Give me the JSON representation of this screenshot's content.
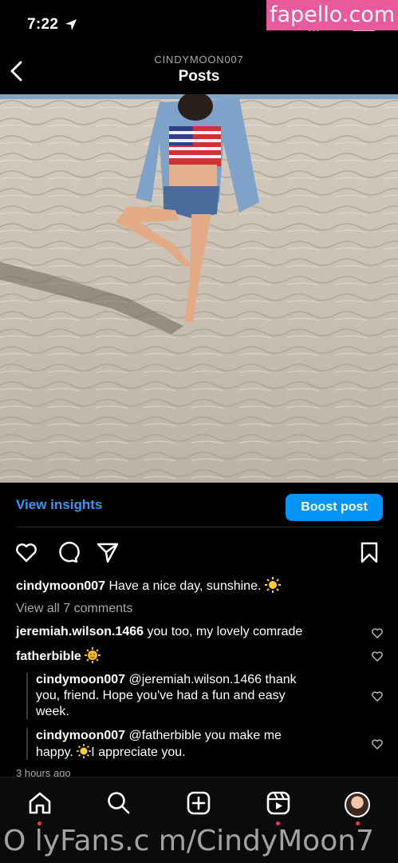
{
  "status_bar": {
    "time": "7:22",
    "location-icon": "location-arrow-icon",
    "battery_color": "#4cd964"
  },
  "watermark_top": "fapello.com",
  "header": {
    "username": "CINDYMOON007",
    "title": "Posts"
  },
  "post": {
    "image_alt": "beach photo",
    "insights_label": "View insights",
    "boost_label": "Boost post",
    "caption": {
      "user": "cindymoon007",
      "text": "Have a nice day, sunshine."
    },
    "view_comments": "View all 7 comments",
    "comments": [
      {
        "user": "jeremiah.wilson.1466",
        "text": "you too, my lovely comrade"
      },
      {
        "user": "fatherbible",
        "text": ""
      }
    ],
    "replies": [
      {
        "user": "cindymoon007",
        "text_line1": "@jeremiah.wilson.1466 thank",
        "text_line2": "you, friend. Hope you've had a fun and easy",
        "text_line3": "week."
      },
      {
        "user": "cindymoon007",
        "text_line1": "@fatherbible you make me",
        "text_line2_a": "happy. ",
        "text_line2_b": "I appreciate you."
      }
    ],
    "time_ago": "3 hours ago"
  },
  "nav": {
    "items": [
      "home-icon",
      "search-icon",
      "create-icon",
      "reels-icon",
      "profile-avatar"
    ]
  },
  "watermark_bottom": "O lyFans.c m/CindyMoon7",
  "colors": {
    "accent": "#0095f6",
    "link": "#3897f0",
    "notification": "#ff3040"
  }
}
